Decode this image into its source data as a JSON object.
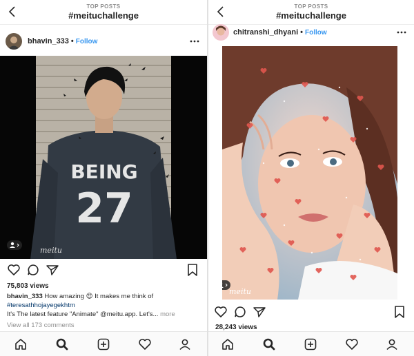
{
  "screens": [
    {
      "topbar": {
        "overline": "TOP POSTS",
        "title": "#meituchallenge"
      },
      "post": {
        "username": "bhavin_333",
        "follow_label": "Follow",
        "image_alt": "Young man in grey BEING 27 sweatshirt standing against wooden wall",
        "shirt_text_1": "BEING",
        "shirt_text_2": "27",
        "watermark": "meitu",
        "views": "75,803 views",
        "caption": {
          "username": "bhavin_333",
          "text_before_emoji": " How amazing ",
          "emoji": "😍",
          "text_after_emoji": " It makes me think of",
          "hashtag": "#teresathhojayegekhtm",
          "line2": "It's The latest feature \"Animate\" @meitu.app. Let's...",
          "more": "more"
        },
        "comments_link": "View all 173 comments"
      }
    },
    {
      "topbar": {
        "overline": "TOP POSTS",
        "title": "#meituchallenge"
      },
      "post": {
        "username": "chitranshi_dhyani",
        "follow_label": "Follow",
        "image_alt": "Woman resting face on hands with floating heart animation",
        "watermark": "meitu",
        "views": "28,243 views"
      }
    }
  ],
  "icons": {
    "back": "chevron-left-icon",
    "more": "more-horizontal-icon",
    "like": "heart-icon",
    "comment": "comment-icon",
    "share": "paper-plane-icon",
    "save": "bookmark-icon",
    "home": "home-icon",
    "search": "search-icon",
    "add": "add-post-icon",
    "activity": "heart-activity-icon",
    "profile": "profile-icon"
  },
  "colors": {
    "link_blue": "#3897f0",
    "text": "#262626",
    "muted": "#8e8e8e",
    "hashtag": "#003569"
  }
}
